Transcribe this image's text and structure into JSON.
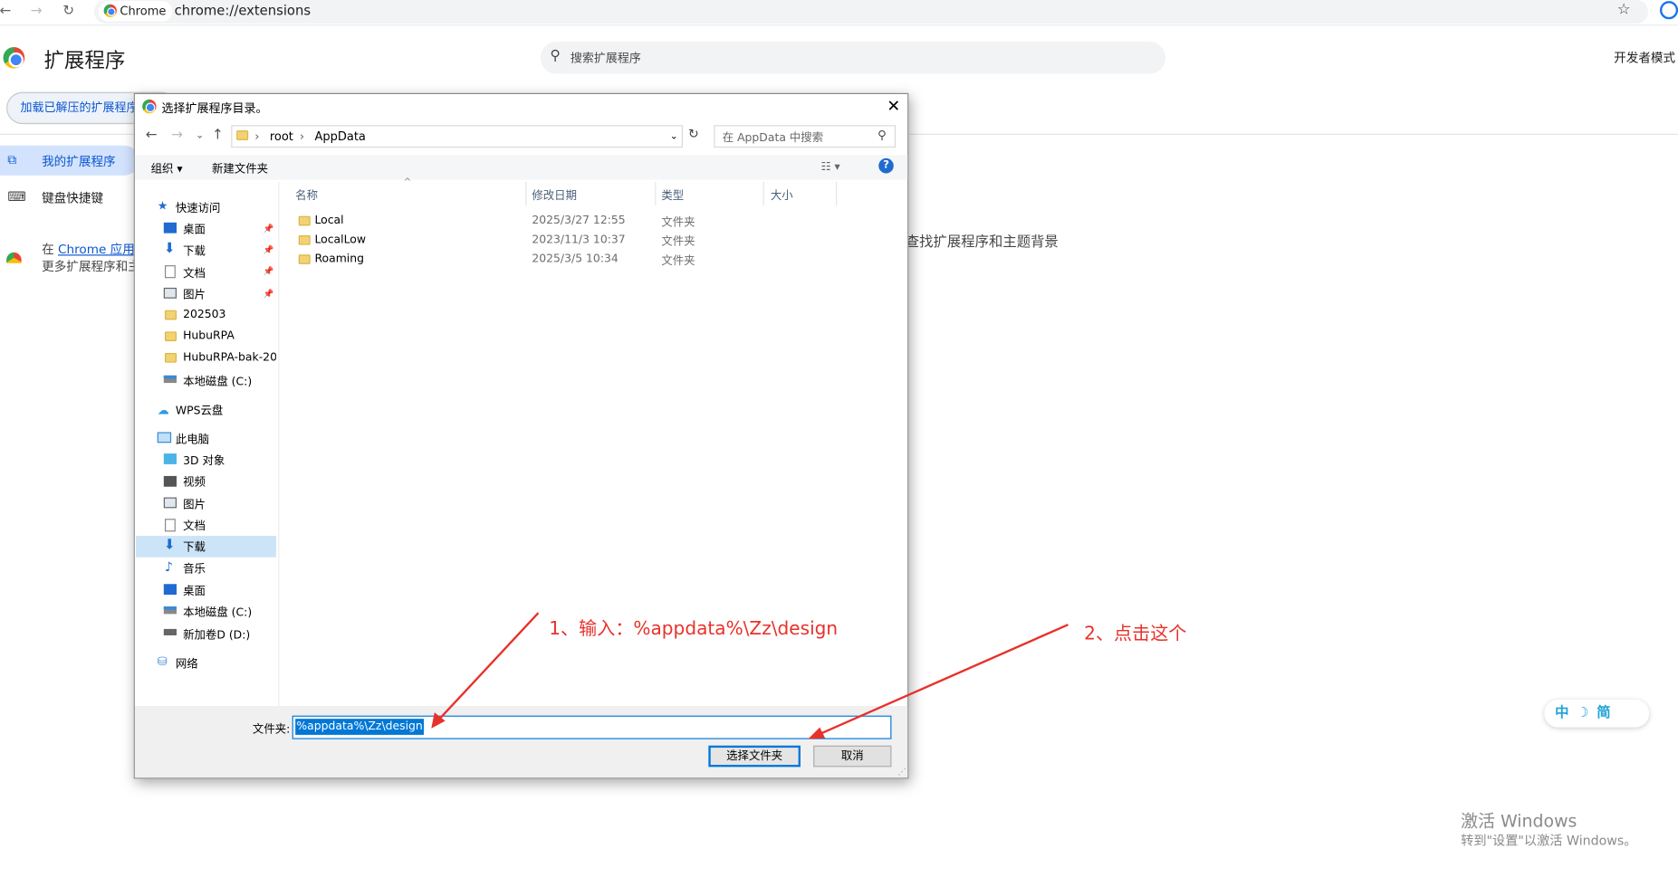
{
  "browser": {
    "chip_label": "Chrome",
    "url": "chrome://extensions"
  },
  "extensions_page": {
    "title": "扩展程序",
    "search_placeholder": "搜索扩展程序",
    "developer_mode_label": "开发者模式",
    "load_unpacked_label": "加载已解压的扩展程序",
    "sidebar": {
      "items": [
        {
          "label": "我的扩展程序",
          "selected": true
        },
        {
          "label": "键盘快捷键",
          "selected": false
        }
      ]
    },
    "webstore_prefix": "在",
    "webstore_link": "Chrome 应用",
    "webstore_line2": "更多扩展程序和主",
    "right_fragment": "查找扩展程序和主题背景"
  },
  "dialog": {
    "title": "选择扩展程序目录。",
    "breadcrumb": [
      "root",
      "AppData"
    ],
    "search_placeholder": "在 AppData 中搜索",
    "toolbar": {
      "organize": "组织 ▾",
      "new_folder": "新建文件夹"
    },
    "nav": {
      "quick_access": "快速访问",
      "quick_items": [
        "桌面",
        "下载",
        "文档",
        "图片",
        "202503",
        "HubuRPA",
        "HubuRPA-bak-20",
        "本地磁盘 (C:)"
      ],
      "wps": "WPS云盘",
      "this_pc": "此电脑",
      "pc_items": [
        "3D 对象",
        "视频",
        "图片",
        "文档",
        "下载",
        "音乐",
        "桌面",
        "本地磁盘 (C:)",
        "新加卷D (D:)"
      ],
      "network": "网络",
      "selected": "下载"
    },
    "columns": {
      "name": "名称",
      "date": "修改日期",
      "type": "类型",
      "size": "大小"
    },
    "files": [
      {
        "name": "Local",
        "date": "2025/3/27 12:55",
        "type": "文件夹"
      },
      {
        "name": "LocalLow",
        "date": "2023/11/3 10:37",
        "type": "文件夹"
      },
      {
        "name": "Roaming",
        "date": "2025/3/5 10:34",
        "type": "文件夹"
      }
    ],
    "folder_label": "文件夹:",
    "folder_value": "%appdata%\\Zz\\design",
    "ok_label": "选择文件夹",
    "cancel_label": "取消"
  },
  "annotations": {
    "step1": "1、输入：%appdata%\\Zz\\design",
    "step2": "2、点击这个",
    "color": "#e8312a"
  },
  "ime": {
    "mode_cn": "中",
    "simplified": "简"
  },
  "watermark": {
    "line1": "激活 Windows",
    "line2": "转到\"设置\"以激活 Windows。"
  }
}
